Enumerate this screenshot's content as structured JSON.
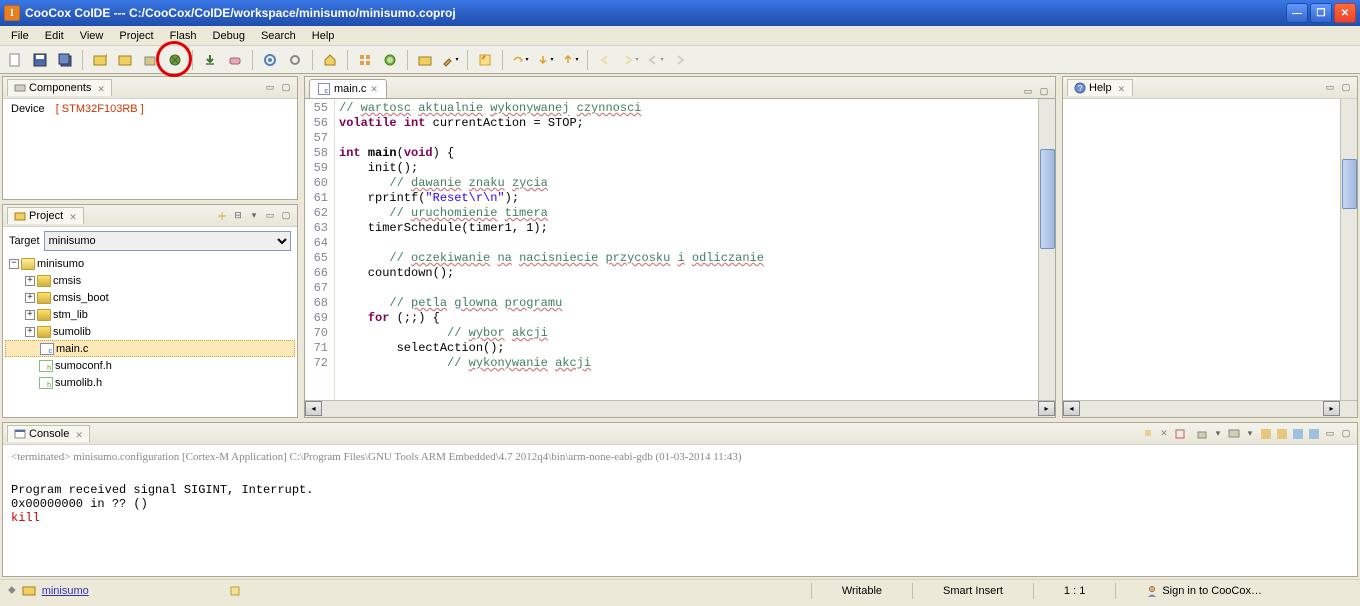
{
  "title": "CooCox CoIDE  ---  C:/CooCox/CoIDE/workspace/minisumo/minisumo.coproj",
  "menu": [
    "File",
    "Edit",
    "View",
    "Project",
    "Flash",
    "Debug",
    "Search",
    "Help"
  ],
  "components": {
    "tab": "Components",
    "device_label": "Device",
    "device_value": "[ STM32F103RB ]"
  },
  "project": {
    "tab": "Project",
    "target_label": "Target",
    "target_value": "minisumo",
    "tree": {
      "root": "minisumo",
      "folders": [
        "cmsis",
        "cmsis_boot",
        "stm_lib",
        "sumolib"
      ],
      "files": [
        "main.c",
        "sumoconf.h",
        "sumolib.h"
      ]
    }
  },
  "editor": {
    "tab": "main.c",
    "lines": [
      {
        "n": 55,
        "type": "comment",
        "text": "// wartosc aktualnie wykonywanej czynnosci"
      },
      {
        "n": 56,
        "type": "code",
        "html": "<span class='kw'>volatile</span> <span class='kw'>int</span> currentAction = STOP;"
      },
      {
        "n": 57,
        "type": "blank",
        "text": ""
      },
      {
        "n": 58,
        "type": "code",
        "html": "<span class='kw'>int</span> <b>main</b>(<span class='kw'>void</span>) {"
      },
      {
        "n": 59,
        "type": "code",
        "html": "    init();"
      },
      {
        "n": 60,
        "type": "comment",
        "text": "    // dawanie znaku zycia"
      },
      {
        "n": 61,
        "type": "code",
        "html": "    rprintf(<span class='str'>\"Reset\\r\\n\"</span>);"
      },
      {
        "n": 62,
        "type": "comment",
        "text": "    // uruchomienie timera"
      },
      {
        "n": 63,
        "type": "code",
        "html": "    timerSchedule(timer1, 1);"
      },
      {
        "n": 64,
        "type": "blank",
        "text": ""
      },
      {
        "n": 65,
        "type": "comment",
        "text": "    // oczekiwanie na nacisniecie przycosku i odliczanie"
      },
      {
        "n": 66,
        "type": "code",
        "html": "    countdown();"
      },
      {
        "n": 67,
        "type": "blank",
        "text": ""
      },
      {
        "n": 68,
        "type": "comment",
        "text": "    // petla glowna programu"
      },
      {
        "n": 69,
        "type": "code",
        "html": "    <span class='kw'>for</span> (;;) {"
      },
      {
        "n": 70,
        "type": "comment",
        "text": "        // wybor akcji"
      },
      {
        "n": 71,
        "type": "code",
        "html": "        selectAction();"
      },
      {
        "n": 72,
        "type": "comment",
        "text": "        // wykonywanie akcji"
      }
    ]
  },
  "help": {
    "tab": "Help"
  },
  "console": {
    "tab": "Console",
    "info": "<terminated> minisumo.configuration [Cortex-M Application] C:\\Program Files\\GNU Tools ARM Embedded\\4.7 2012q4\\bin\\arm-none-eabi-gdb (01-03-2014 11:43)",
    "lines": [
      "",
      "Program received signal SIGINT, Interrupt.",
      "0x00000000 in ?? ()"
    ],
    "red_line": "kill"
  },
  "statusbar": {
    "project_link": "minisumo",
    "writable": "Writable",
    "insert": "Smart Insert",
    "pos": "1 : 1",
    "signin": "Sign in to CooCox…"
  }
}
